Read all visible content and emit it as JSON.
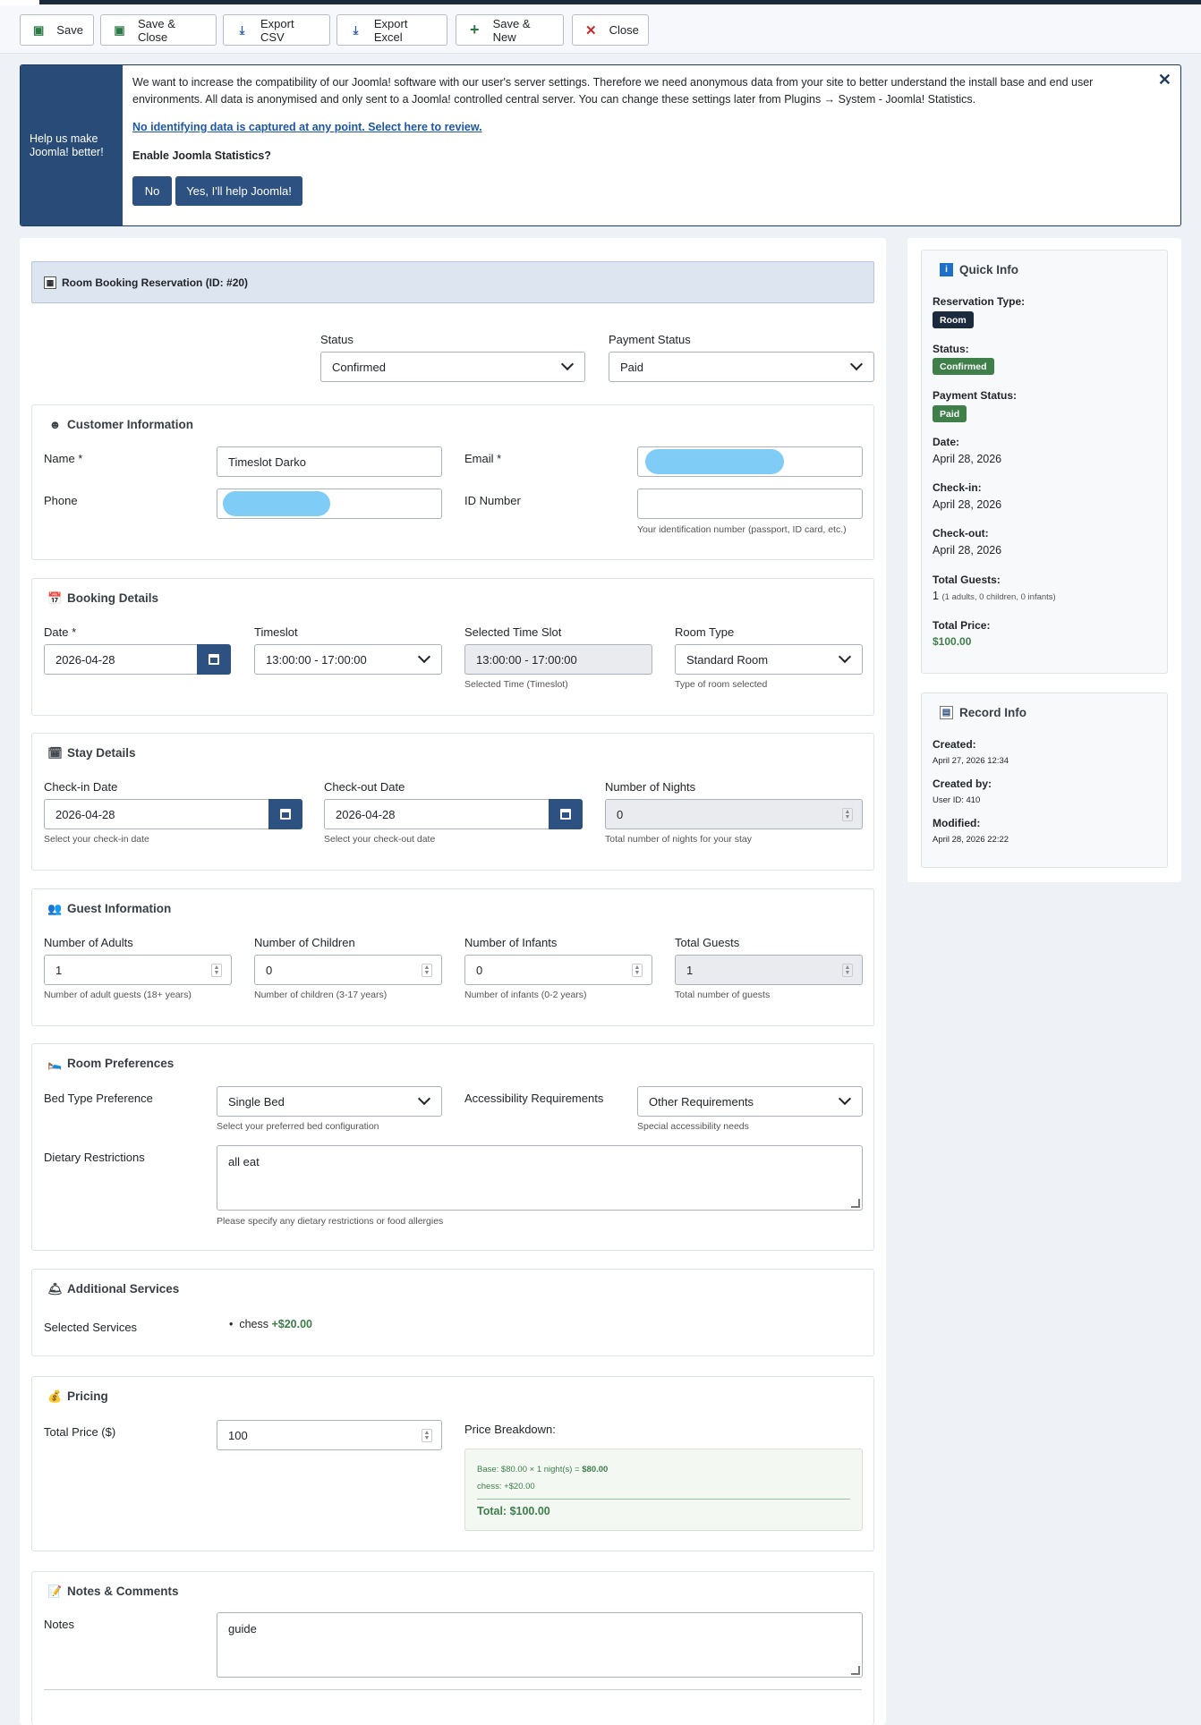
{
  "toolbar": {
    "save": "Save",
    "save_close": "Save & Close",
    "export_csv": "Export CSV",
    "export_excel": "Export Excel",
    "save_new": "Save & New",
    "close": "Close"
  },
  "stats_banner": {
    "side_text": "Help us make Joomla! better!",
    "message": "We want to increase the compatibility of our Joomla! software with our user's server settings. Therefore we need anonymous data from your site to better understand the install base and end user environments. All data is anonymised and only sent to a Joomla! controlled central server. You can change these settings later from Plugins → System - Joomla! Statistics.",
    "link": "No identifying data is captured at any point. Select here to review.",
    "question": "Enable Joomla Statistics?",
    "no_label": "No",
    "yes_label": "Yes, I'll help Joomla!"
  },
  "form": {
    "title": "Room Booking Reservation (ID: #20)",
    "status": {
      "label": "Status",
      "value": "Confirmed"
    },
    "payment_status": {
      "label": "Payment Status",
      "value": "Paid"
    },
    "customer": {
      "title": "Customer Information",
      "name_label": "Name *",
      "name_value": "Timeslot Darko",
      "email_label": "Email *",
      "phone_label": "Phone",
      "id_label": "ID Number",
      "id_hint": "Your identification number (passport, ID card, etc.)"
    },
    "booking": {
      "title": "Booking Details",
      "date_label": "Date *",
      "date_value": "2026-04-28",
      "timeslot_label": "Timeslot",
      "timeslot_value": "13:00:00 - 17:00:00",
      "selected_label": "Selected Time Slot",
      "selected_value": "13:00:00 - 17:00:00",
      "selected_hint": "Selected Time (Timeslot)",
      "room_type_label": "Room Type",
      "room_type_value": "Standard Room",
      "room_type_hint": "Type of room selected"
    },
    "stay": {
      "title": "Stay Details",
      "checkin_label": "Check-in Date",
      "checkin_value": "2026-04-28",
      "checkin_hint": "Select your check-in date",
      "checkout_label": "Check-out Date",
      "checkout_value": "2026-04-28",
      "checkout_hint": "Select your check-out date",
      "nights_label": "Number of Nights",
      "nights_value": "0",
      "nights_hint": "Total number of nights for your stay"
    },
    "guests": {
      "title": "Guest Information",
      "adults_label": "Number of Adults",
      "adults_value": "1",
      "adults_hint": "Number of adult guests (18+ years)",
      "children_label": "Number of Children",
      "children_value": "0",
      "children_hint": "Number of children (3-17 years)",
      "infants_label": "Number of Infants",
      "infants_value": "0",
      "infants_hint": "Number of infants (0-2 years)",
      "total_label": "Total Guests",
      "total_value": "1",
      "total_hint": "Total number of guests"
    },
    "preferences": {
      "title": "Room Preferences",
      "bed_label": "Bed Type Preference",
      "bed_value": "Single Bed",
      "bed_hint": "Select your preferred bed configuration",
      "access_label": "Accessibility Requirements",
      "access_value": "Other Requirements",
      "access_hint": "Special accessibility needs",
      "dietary_label": "Dietary Restrictions",
      "dietary_value": "all eat",
      "dietary_hint": "Please specify any dietary restrictions or food allergies"
    },
    "services": {
      "title": "Additional Services",
      "label": "Selected Services",
      "item_name": "chess",
      "item_price": "+$20.00"
    },
    "pricing": {
      "title": "Pricing",
      "total_label": "Total Price ($)",
      "total_value": "100",
      "breakdown_label": "Price Breakdown:",
      "base_text": "Base: $80.00 × 1 night(s) = ",
      "base_amount": "$80.00",
      "chess_line": "chess: +$20.00",
      "total_line": "Total: $100.00"
    },
    "notes": {
      "title": "Notes & Comments",
      "label": "Notes",
      "value": "guide"
    }
  },
  "quick_info": {
    "title": "Quick Info",
    "res_type_label": "Reservation Type:",
    "res_type_value": "Room",
    "status_label": "Status:",
    "status_value": "Confirmed",
    "payment_label": "Payment Status:",
    "payment_value": "Paid",
    "date_label": "Date:",
    "date_value": "April 28, 2026",
    "checkin_label": "Check-in:",
    "checkin_value": "April 28, 2026",
    "checkout_label": "Check-out:",
    "checkout_value": "April 28, 2026",
    "guests_label": "Total Guests:",
    "guests_value": "1",
    "guests_detail": "(1 adults, 0 children, 0 infants)",
    "price_label": "Total Price:",
    "price_value": "$100.00"
  },
  "record_info": {
    "title": "Record Info",
    "created_label": "Created:",
    "created_value": "April 27, 2026 12:34",
    "created_by_label": "Created by:",
    "created_by_value": "User ID: 410",
    "modified_label": "Modified:",
    "modified_value": "April 28, 2026 22:22"
  },
  "colors": {
    "primary": "#2d5180",
    "success": "#3e7f4a",
    "dark_badge": "#1c2a3d"
  }
}
